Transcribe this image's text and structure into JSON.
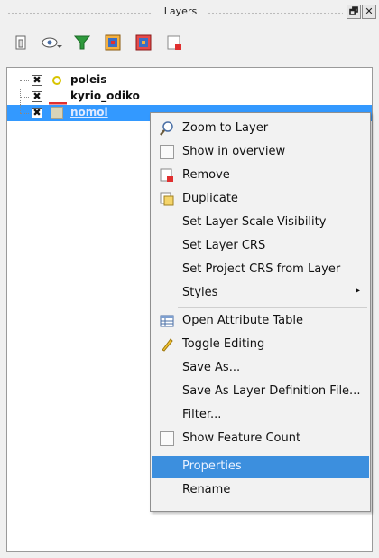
{
  "window": {
    "title": "Layers",
    "float_label": "🗗",
    "close_label": "✕"
  },
  "toolbar": {
    "tools": [
      {
        "icon": "add-group-icon"
      },
      {
        "icon": "manage-visibility-icon"
      },
      {
        "icon": "filter-legend-icon"
      },
      {
        "icon": "expand-all-icon"
      },
      {
        "icon": "collapse-all-icon"
      },
      {
        "icon": "remove-layer-icon"
      }
    ]
  },
  "layers": [
    {
      "name": "poleis",
      "checked": "✖",
      "symbol": "point"
    },
    {
      "name": "kyrio_odiko",
      "checked": "✖",
      "symbol": "line"
    },
    {
      "name": "nomoi",
      "checked": "✖",
      "symbol": "polygon",
      "selected": true
    }
  ],
  "context_menu": {
    "items": [
      {
        "label": "Zoom to Layer",
        "icon": "zoom-icon"
      },
      {
        "label": "Show in overview",
        "icon": "checkbox-icon"
      },
      {
        "label": "Remove",
        "icon": "remove-icon"
      },
      {
        "label": "Duplicate",
        "icon": "duplicate-icon"
      },
      {
        "label": "Set Layer Scale Visibility"
      },
      {
        "label": "Set Layer CRS"
      },
      {
        "label": "Set Project CRS from Layer"
      },
      {
        "label": "Styles",
        "submenu": "▸"
      },
      {
        "label": "Open Attribute Table",
        "icon": "table-icon"
      },
      {
        "label": "Toggle Editing",
        "icon": "pencil-icon"
      },
      {
        "label": "Save As..."
      },
      {
        "label": "Save As Layer Definition File..."
      },
      {
        "label": "Filter..."
      },
      {
        "label": "Show Feature Count",
        "icon": "checkbox-icon"
      },
      {
        "label": "Properties",
        "highlighted": true
      },
      {
        "label": "Rename"
      }
    ]
  },
  "colors": {
    "selection": "#3399ff",
    "menu_highlight": "#3c8fde",
    "point_symbol": "#d8c400",
    "line_symbol": "#e03030",
    "polygon_symbol": "#d9d4b8"
  }
}
